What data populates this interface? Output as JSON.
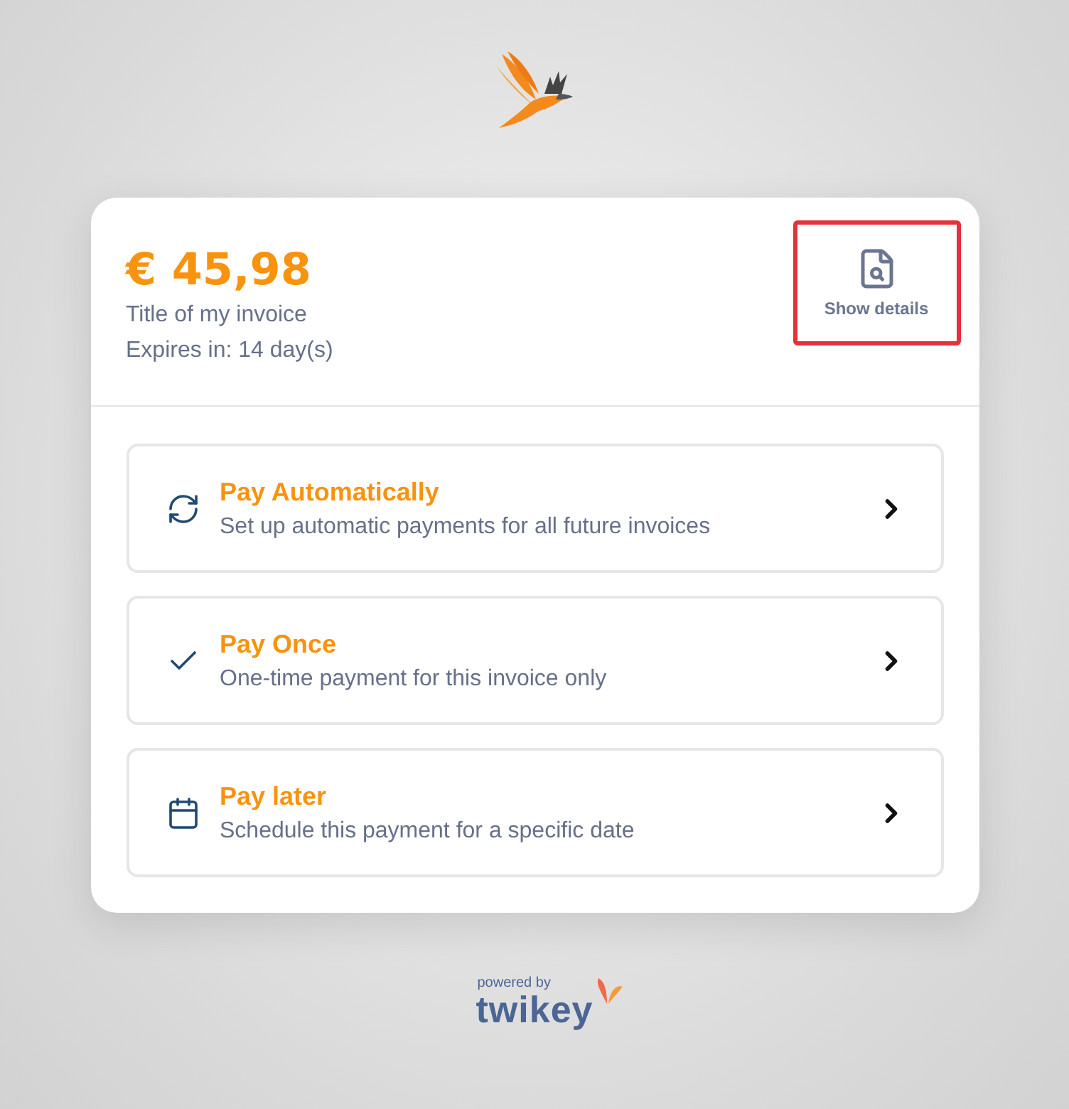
{
  "invoice": {
    "amount": "€ 45,98",
    "title": "Title of my invoice",
    "expiry": "Expires in: 14 day(s)"
  },
  "details_button": {
    "label": "Show details",
    "highlighted": true
  },
  "options": [
    {
      "kind": "automatic",
      "title": "Pay Automatically",
      "description": "Set up automatic payments for all future invoices"
    },
    {
      "kind": "once",
      "title": "Pay Once",
      "description": "One-time payment for this invoice only"
    },
    {
      "kind": "later",
      "title": "Pay later",
      "description": "Schedule this payment for a specific date"
    }
  ],
  "footer": {
    "powered_by": "powered by",
    "brand": "twikey"
  }
}
